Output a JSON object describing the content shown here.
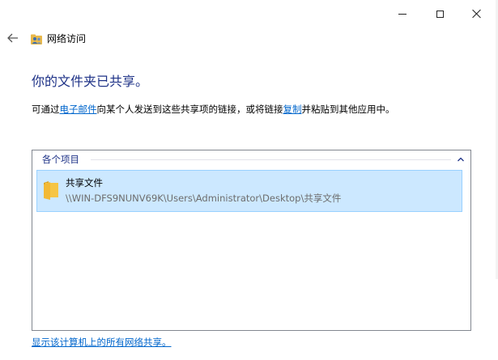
{
  "window": {
    "minimize_icon": "minimize-icon",
    "maximize_icon": "maximize-icon",
    "close_icon": "close-icon"
  },
  "nav": {
    "back_icon": "back-arrow-icon",
    "app_icon": "network-users-icon",
    "title": "网络访问"
  },
  "heading": "你的文件夹已共享。",
  "description": {
    "prefix": "可通过",
    "email_link": "电子邮件",
    "middle": "向某个人发送到这些共享项的链接，或将链接",
    "copy_link": "复制",
    "suffix": "并粘贴到其他应用中。"
  },
  "list": {
    "group_label": "各个项目",
    "group_chevron_icon": "chevron-up-icon",
    "items": [
      {
        "name": "共享文件",
        "path": "\\\\WIN-DFS9NUNV69K\\Users\\Administrator\\Desktop\\共享文件",
        "icon": "folder-icon",
        "selected": true
      }
    ]
  },
  "footer_link": "显示该计算机上的所有网络共享。",
  "colors": {
    "heading": "#1e3287",
    "link": "#0066cc",
    "selection_bg": "#cce8ff",
    "selection_border": "#99d1ff"
  }
}
